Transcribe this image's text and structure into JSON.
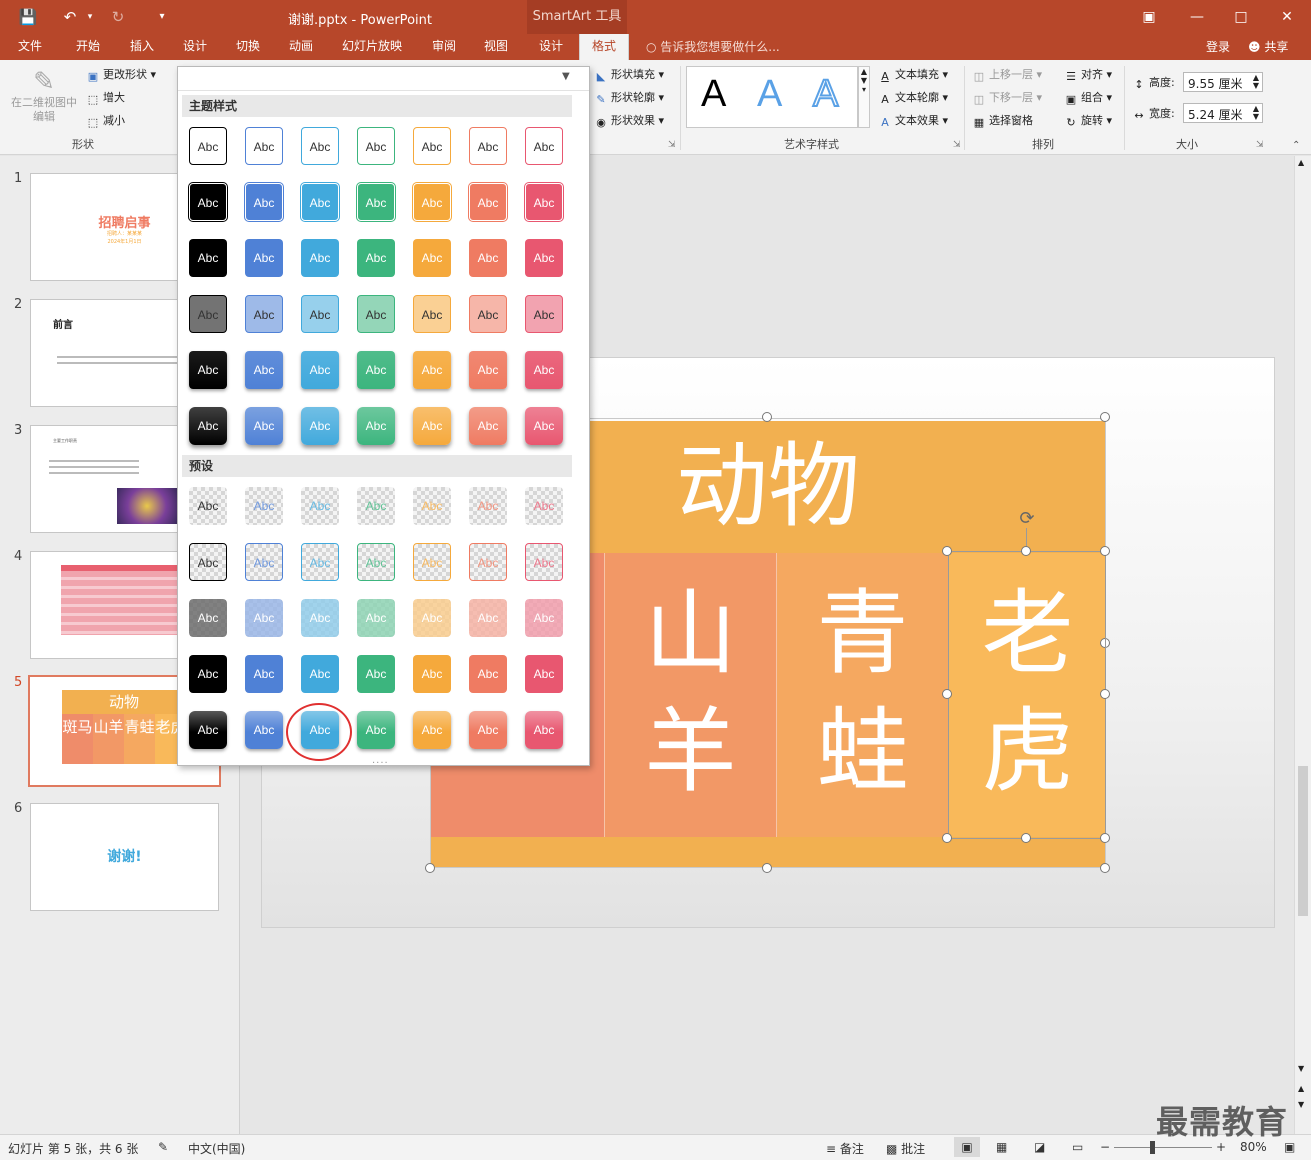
{
  "window": {
    "title": "谢谢.pptx - PowerPoint",
    "context_tab": "SmartArt 工具"
  },
  "tabs": [
    "文件",
    "开始",
    "插入",
    "设计",
    "切换",
    "动画",
    "幻灯片放映",
    "审阅",
    "视图",
    "设计",
    "格式"
  ],
  "tell_me": "告诉我您想要做什么...",
  "login": "登录",
  "share": "共享",
  "ribbon": {
    "edit_2d": "在二维视图中编辑",
    "change_shape": "更改形状",
    "bigger": "增大",
    "smaller": "减小",
    "group_shapes": "形状",
    "shape_fill": "形状填充",
    "shape_outline": "形状轮廓",
    "shape_effect": "形状效果",
    "art_letter": "A",
    "text_fill": "文本填充",
    "text_outline": "文本轮廓",
    "text_effect": "文本效果",
    "group_wordart": "艺术字样式",
    "bring_forward": "上移一层",
    "send_backward": "下移一层",
    "selection_pane": "选择窗格",
    "align": "对齐",
    "group": "组合",
    "rotate": "旋转",
    "group_arrange": "排列",
    "height_label": "高度:",
    "height_value": "9.55 厘米",
    "width_label": "宽度:",
    "width_value": "5.24 厘米",
    "group_size": "大小"
  },
  "gallery": {
    "section_theme": "主题样式",
    "section_preset": "预设",
    "swatch_text": "Abc",
    "grip": "....",
    "colors": [
      "#000000",
      "#4f81d6",
      "#41a9dc",
      "#3cb57e",
      "#f5a93c",
      "#ef7b62",
      "#e85770"
    ]
  },
  "slides": {
    "numbers": [
      "1",
      "2",
      "3",
      "4",
      "5",
      "6"
    ],
    "s1_title": "招聘启事",
    "s1_sub": "招聘人：某某某",
    "s1_date": "2024年1月1日",
    "s2_title": "前言",
    "s3_title": "主要工作职责",
    "s5_header": "动物",
    "s5_cells": [
      "斑马",
      "山羊",
      "青蛙",
      "老虎"
    ],
    "s6_title": "谢谢!"
  },
  "smartart": {
    "header": "动物",
    "cells": [
      "马",
      "山\n羊",
      "青\n蛙",
      "老\n虎"
    ],
    "colors": [
      "#ef8c6a",
      "#f29866",
      "#f5a860",
      "#f9b95a"
    ]
  },
  "status": {
    "slide_info": "幻灯片 第 5 张，共 6 张",
    "language": "中文(中国)",
    "notes": "备注",
    "comments": "批注",
    "zoom": "80%"
  },
  "watermark": "最需教育"
}
